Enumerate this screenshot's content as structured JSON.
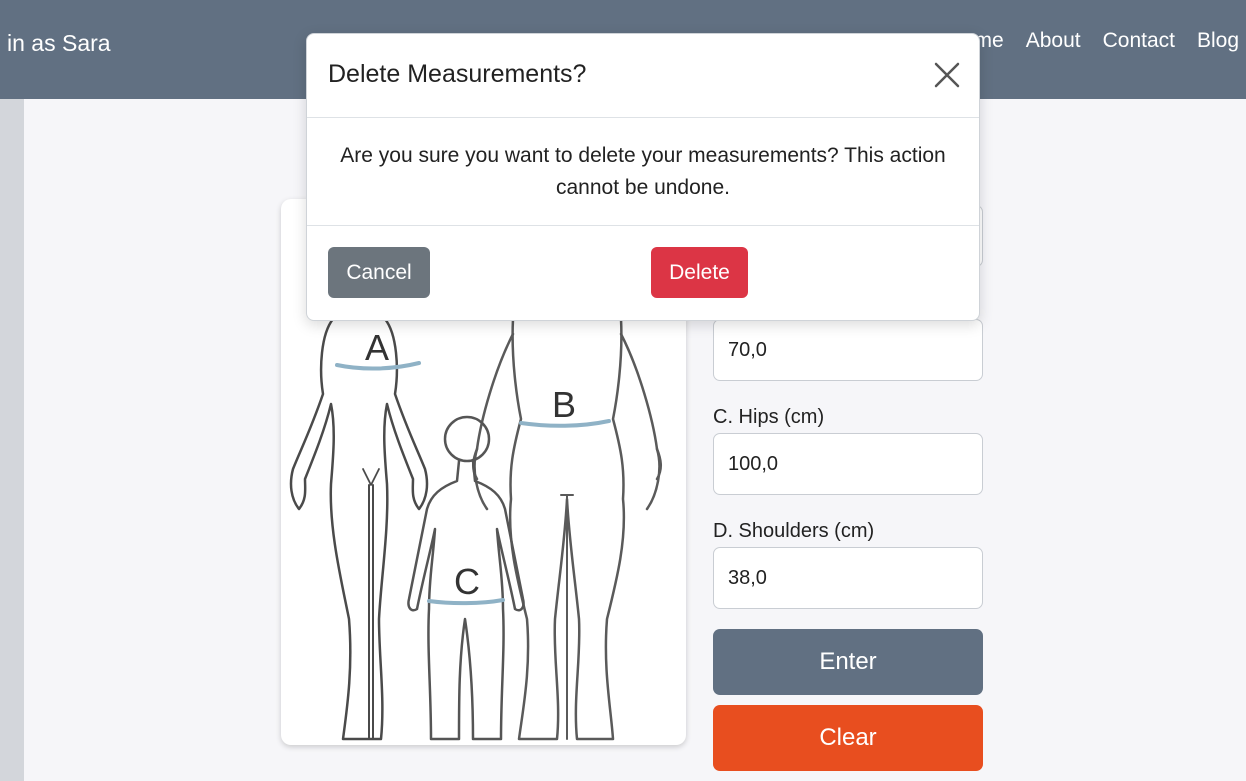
{
  "nav": {
    "user_text": "in as Sara",
    "links": [
      "me",
      "About",
      "Contact",
      "Blog"
    ]
  },
  "figure": {
    "labels": {
      "a": "A",
      "b": "B",
      "c": "C"
    },
    "colors": {
      "outline": "#555555",
      "band": "#8fb2c6"
    }
  },
  "form": {
    "fields": [
      {
        "label": "",
        "value": ""
      },
      {
        "label": "",
        "value": "70,0"
      },
      {
        "label": "C. Hips (cm)",
        "value": "100,0"
      },
      {
        "label": "D. Shoulders (cm)",
        "value": "38,0"
      }
    ],
    "enter_label": "Enter",
    "clear_label": "Clear"
  },
  "modal": {
    "title": "Delete Measurements?",
    "body": "Are you sure you want to delete your measurements? This action cannot be undone.",
    "cancel_label": "Cancel",
    "delete_label": "Delete"
  },
  "colors": {
    "navbar": "#617082",
    "enter": "#617082",
    "clear": "#e84e1f",
    "cancel": "#6c757d",
    "delete": "#dc3545"
  }
}
